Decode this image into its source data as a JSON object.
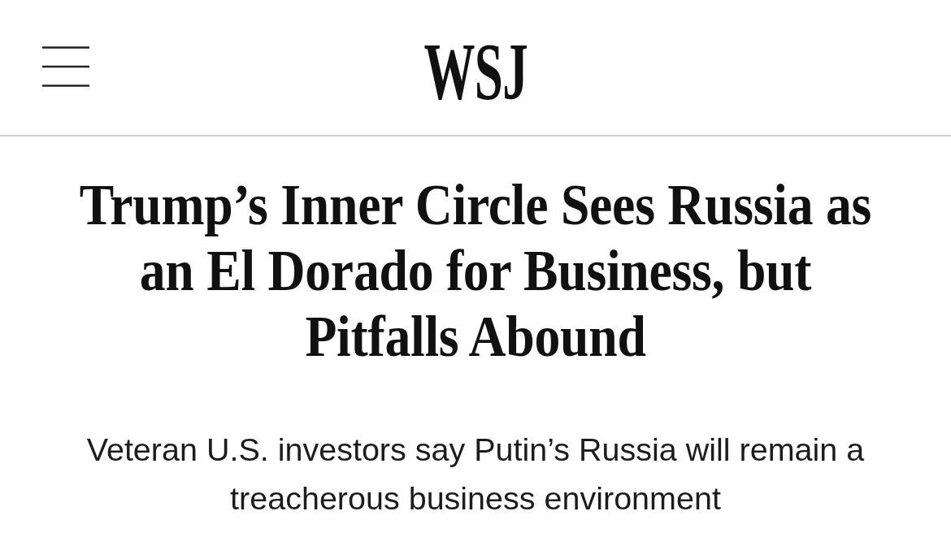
{
  "header": {
    "logo": "WSJ"
  },
  "article": {
    "headline": "Trump’s Inner Circle Sees Russia as an El Dorado for Business, but Pitfalls Abound",
    "dek": "Veteran U.S. investors say Putin’s Russia will remain a treacherous business environment"
  }
}
